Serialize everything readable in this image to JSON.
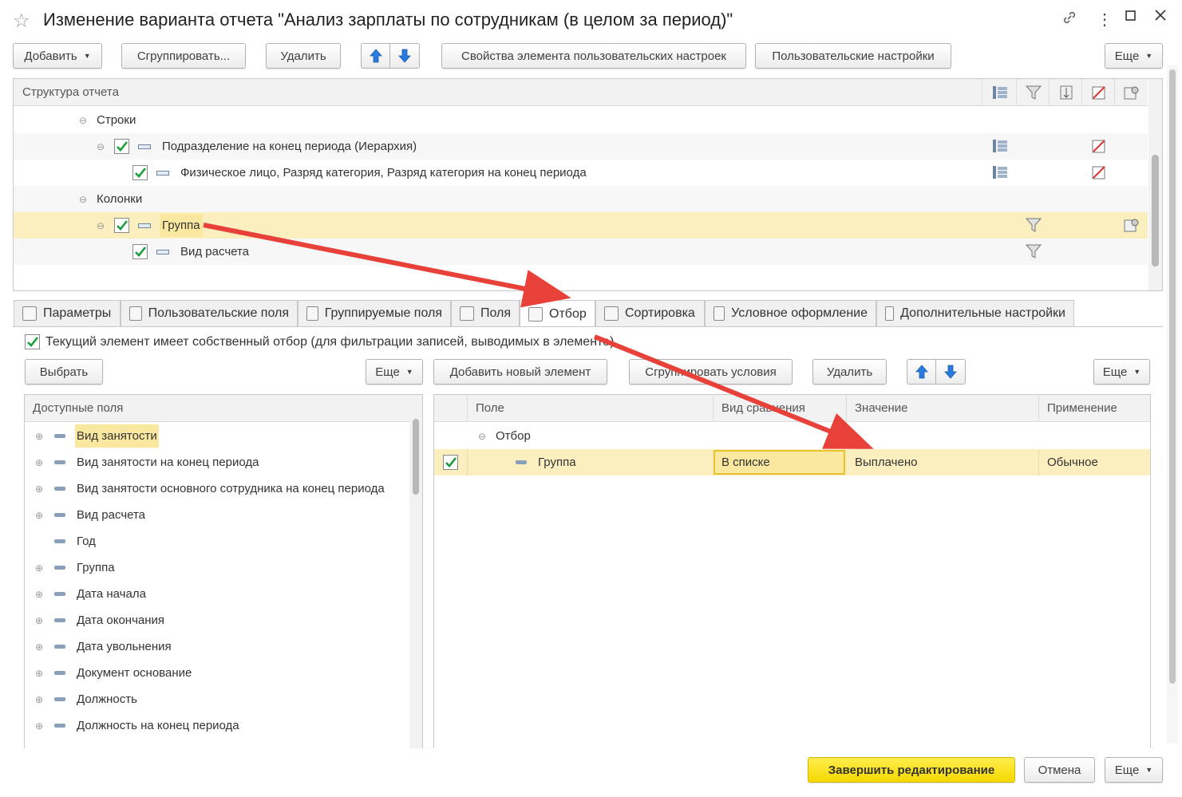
{
  "window": {
    "title": "Изменение варианта отчета \"Анализ зарплаты по сотрудникам (в целом за период)\""
  },
  "toolbar": {
    "add": "Добавить",
    "group": "Сгруппировать...",
    "delete": "Удалить",
    "element_props": "Свойства элемента пользовательских настроек",
    "user_settings": "Пользовательские настройки",
    "more": "Еще"
  },
  "structure": {
    "header": "Структура отчета",
    "rows": [
      {
        "label": "Строки"
      },
      {
        "label": "Подразделение на конец периода (Иерархия)",
        "checked": true
      },
      {
        "label": "Физическое лицо, Разряд категория, Разряд категория на конец периода",
        "checked": true
      },
      {
        "label": "Колонки"
      },
      {
        "label": "Группа",
        "checked": true
      },
      {
        "label": "Вид расчета",
        "checked": true
      }
    ]
  },
  "tabs": [
    {
      "label": "Параметры"
    },
    {
      "label": "Пользовательские поля"
    },
    {
      "label": "Группируемые поля"
    },
    {
      "label": "Поля"
    },
    {
      "label": "Отбор",
      "active": true
    },
    {
      "label": "Сортировка"
    },
    {
      "label": "Условное оформление"
    },
    {
      "label": "Дополнительные настройки"
    }
  ],
  "filter": {
    "own_filter_label": "Текущий элемент имеет собственный отбор (для фильтрации записей, выводимых в элементе)",
    "own_filter_checked": true,
    "select": "Выбрать",
    "more": "Еще",
    "add_new": "Добавить новый элемент",
    "group_conditions": "Сгруппировать условия",
    "delete": "Удалить",
    "available_header": "Доступные поля",
    "available_fields": [
      {
        "label": "Вид занятости",
        "expandable": true
      },
      {
        "label": "Вид занятости на конец периода",
        "expandable": true
      },
      {
        "label": "Вид занятости основного сотрудника на конец периода",
        "expandable": true
      },
      {
        "label": "Вид расчета",
        "expandable": true
      },
      {
        "label": "Год",
        "expandable": false
      },
      {
        "label": "Группа",
        "expandable": true
      },
      {
        "label": "Дата начала",
        "expandable": true
      },
      {
        "label": "Дата окончания",
        "expandable": true
      },
      {
        "label": "Дата увольнения",
        "expandable": true
      },
      {
        "label": "Документ основание",
        "expandable": true
      },
      {
        "label": "Должность",
        "expandable": true
      },
      {
        "label": "Должность на конец периода",
        "expandable": true
      }
    ],
    "columns": {
      "field": "Поле",
      "comparison": "Вид сравнения",
      "value": "Значение",
      "usage": "Применение"
    },
    "group_row": "Отбор",
    "item": {
      "checked": true,
      "field": "Группа",
      "comparison": "В списке",
      "value": "Выплачено",
      "usage": "Обычное"
    }
  },
  "footer": {
    "finish": "Завершить редактирование",
    "cancel": "Отмена",
    "more": "Еще"
  },
  "colors": {
    "primary_button": "#f5d800",
    "selected_row": "#fcefbf",
    "annotation_arrow": "#e8413a"
  }
}
